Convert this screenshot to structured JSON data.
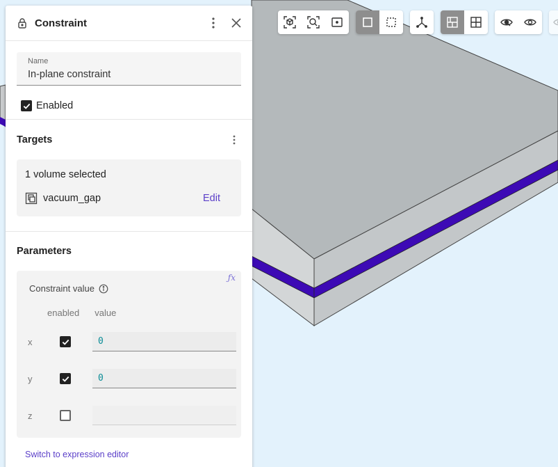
{
  "panel": {
    "title": "Constraint",
    "name_label": "Name",
    "name_value": "In-plane constraint",
    "enabled_label": "Enabled",
    "enabled": true
  },
  "targets": {
    "heading": "Targets",
    "count_text": "1 volume selected",
    "items": [
      {
        "name": "vacuum_gap",
        "action": "Edit"
      }
    ]
  },
  "parameters": {
    "heading": "Parameters",
    "fx_glyph": "ƒx",
    "constraint_label": "Constraint value",
    "col_enabled": "enabled",
    "col_value": "value",
    "rows": [
      {
        "axis": "x",
        "enabled": true,
        "value": "0"
      },
      {
        "axis": "y",
        "enabled": true,
        "value": "0"
      },
      {
        "axis": "z",
        "enabled": false,
        "value": ""
      }
    ],
    "expression_link": "Switch to expression editor"
  },
  "colors": {
    "accent": "#5a3ec8",
    "gap_band": "#3d0ab5",
    "slab": "#b3b8ba",
    "background": "#e3f2fc"
  }
}
